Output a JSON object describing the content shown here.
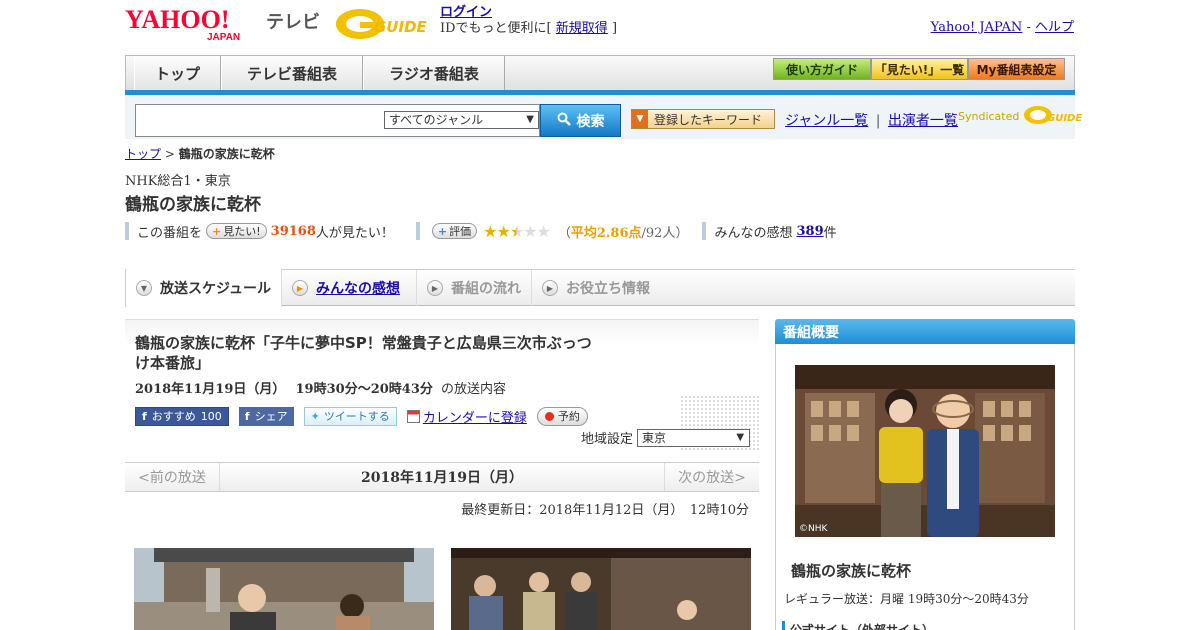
{
  "header": {
    "yahoo_logo": "YAHOO!",
    "yahoo_sub": "JAPAN",
    "tv_label": "テレビ",
    "gguide_logo": "GUIDE",
    "login": "ログイン",
    "login_note": "IDでもっと便利に[",
    "register": "新規取得",
    "login_close": "]",
    "yahoo_japan": "Yahoo! JAPAN",
    "dash": "-",
    "help": "ヘルプ"
  },
  "nav": {
    "tabs": [
      "トップ",
      "テレビ番組表",
      "ラジオ番組表"
    ],
    "buttons": [
      "使い方ガイド",
      "「見たい!」一覧",
      "My番組表設定"
    ]
  },
  "search": {
    "genre": "すべてのジャンル",
    "button": "検索",
    "keyword_button": "登録したキーワード",
    "genre_list": "ジャンル一覧",
    "pipe": "|",
    "cast_list": "出演者一覧",
    "syndicated": "Syndicated",
    "syndicated_logo": "GUIDE"
  },
  "breadcrumb": {
    "top": "トップ",
    "sep": ">",
    "current": "鶴瓶の家族に乾杯"
  },
  "program": {
    "channel": "NHK総合1・東京",
    "title": "鶴瓶の家族に乾杯",
    "mitai_prefix": "この番組を",
    "mitai_button": "見たい!",
    "mitai_count": "39168",
    "mitai_suffix": "人が見たい！",
    "rate_button": "評価",
    "rating": 2.86,
    "avg_open": "（",
    "avg_label": "平均2.86点",
    "avg_count": "/92人）",
    "reviews_label": "みんなの感想",
    "reviews_count": "389",
    "reviews_suffix": "件"
  },
  "program_tabs": [
    "放送スケジュール",
    "みんなの感想",
    "番組の流れ",
    "お役立ち情報"
  ],
  "episode": {
    "title": "鶴瓶の家族に乾杯「子牛に夢中SP！常盤貴子と広島県三次市ぶっつけ本番旅」",
    "date": "2018年11月19日（月）",
    "time": "19時30分～20時43分",
    "date_suffix": "の放送内容",
    "fb_recommend": "おすすめ",
    "fb_count": "100",
    "fb_share": "シェア",
    "tweet": "ツイートする",
    "calendar": "カレンダーに登録",
    "reserve": "予約",
    "region_label": "地域設定",
    "region": "東京"
  },
  "datebar": {
    "prev": "<前の放送",
    "current": "2018年11月19日（月）",
    "next": "次の放送>"
  },
  "updated": "最終更新日：2018年11月12日（月）　12時10分",
  "sidebar": {
    "heading": "番組概要",
    "nhk_mark": "©NHK",
    "title": "鶴瓶の家族に乾杯",
    "regular": "レギュラー放送：月曜 19時30分～20時43分",
    "official": "公式サイト（外部サイト）"
  }
}
